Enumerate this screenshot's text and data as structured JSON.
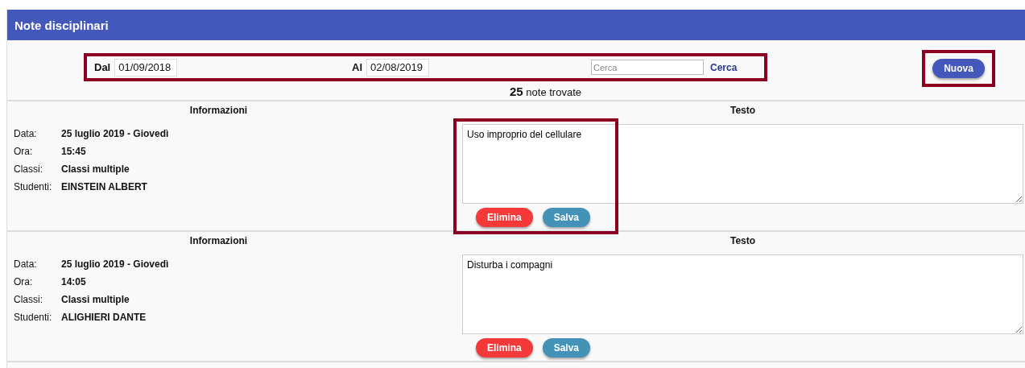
{
  "header": {
    "title": "Note disciplinari"
  },
  "filter": {
    "highlighted": true,
    "from_label": "Dal",
    "from_value": "01/09/2018",
    "to_label": "Al",
    "to_value": "02/08/2019",
    "search_placeholder": "Cerca",
    "search_button": "Cerca"
  },
  "new_button": {
    "label": "Nuova",
    "highlighted": true
  },
  "count": {
    "number": "25",
    "text": "note trovate"
  },
  "notes": [
    {
      "highlighted": true,
      "info_heading": "Informazioni",
      "text_heading": "Testo",
      "fields": [
        {
          "label": "Data:",
          "value": "25 luglio 2019 - Giovedì"
        },
        {
          "label": "Ora:",
          "value": "15:45"
        },
        {
          "label": "Classi:",
          "value": "Classi multiple"
        },
        {
          "label": "Studenti:",
          "value": "EINSTEIN ALBERT"
        }
      ],
      "text": "Uso improprio del cellulare",
      "delete_button": "Elimina",
      "save_button": "Salva"
    },
    {
      "highlighted": false,
      "info_heading": "Informazioni",
      "text_heading": "Testo",
      "fields": [
        {
          "label": "Data:",
          "value": "25 luglio 2019 - Giovedì"
        },
        {
          "label": "Ora:",
          "value": "14:05"
        },
        {
          "label": "Classi:",
          "value": "Classi multiple"
        },
        {
          "label": "Studenti:",
          "value": "ALIGHIERI DANTE"
        }
      ],
      "text": "Disturba i compagni",
      "delete_button": "Elimina",
      "save_button": "Salva"
    }
  ]
}
